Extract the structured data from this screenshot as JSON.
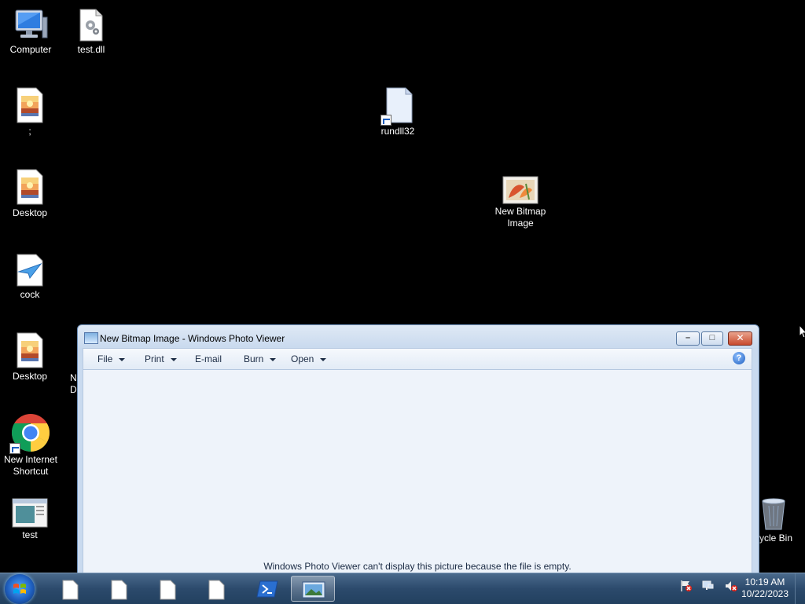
{
  "desktop": {
    "icons": [
      {
        "label": "Computer",
        "icon": "computer-icon"
      },
      {
        "label": "test.dll",
        "icon": "dll-file-icon"
      },
      {
        "label": ";",
        "icon": "image-file-icon"
      },
      {
        "label": "rundll32",
        "icon": "shortcut-file-icon"
      },
      {
        "label": "Desktop",
        "icon": "image-file-icon"
      },
      {
        "label": "New Bitmap Image",
        "icon": "bitmap-icon"
      },
      {
        "label": "cock",
        "icon": "document-icon"
      },
      {
        "label": "Desktop",
        "icon": "image-file-icon"
      },
      {
        "label": "New Internet Shortcut",
        "icon": "chrome-icon"
      },
      {
        "label": "test",
        "icon": "window-app-icon"
      },
      {
        "label": "ycle Bin",
        "icon": "recycle-bin-icon"
      }
    ],
    "partial_label": "N\nD"
  },
  "window": {
    "title": "New Bitmap Image - Windows Photo Viewer",
    "menu": [
      "File",
      "Print",
      "E-mail",
      "Burn",
      "Open"
    ],
    "help": "?",
    "message": "Windows Photo Viewer can't display this picture because the file is empty."
  },
  "taskbar": {
    "apps": [
      "blank-document-icon",
      "blank-document-icon",
      "blank-document-icon",
      "blank-document-icon",
      "powershell-icon",
      "photo-viewer-icon"
    ],
    "clock_time": "10:19 AM",
    "clock_date": "10/22/2023"
  }
}
